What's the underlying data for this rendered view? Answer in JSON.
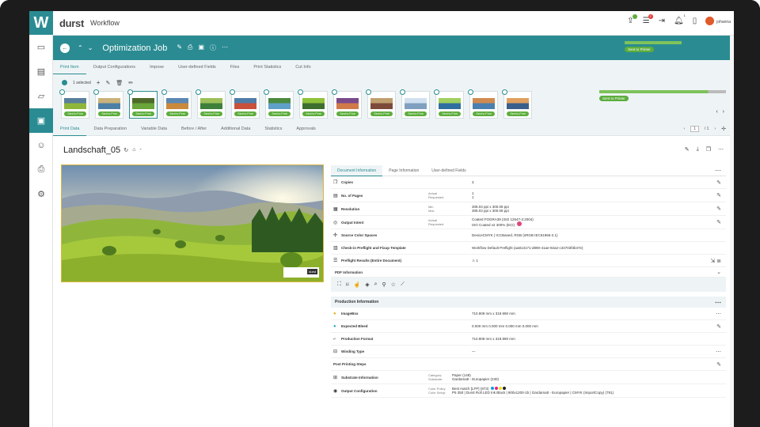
{
  "app": {
    "logo_letter": "W",
    "brand": "durst",
    "name": "Workflow",
    "user": "johanna",
    "notif_counts": [
      "2",
      "1"
    ]
  },
  "colors": {
    "accent": "#2a8c92",
    "success": "#5cad3c",
    "preview_border": "#d9b840"
  },
  "rail": {
    "items": [
      "dashboard-icon",
      "orders-icon",
      "folder-icon",
      "jobs-icon",
      "users-icon",
      "printer-icon",
      "settings-icon"
    ]
  },
  "job": {
    "title": "Optimization Job",
    "status": "Sent to Printer",
    "progress_percent": 100
  },
  "tabs1": [
    "Print Item",
    "Output Configurations",
    "Impose",
    "User-defined Fields",
    "Files",
    "Print Statistics",
    "Cut Info"
  ],
  "selection": {
    "label": "1 selected"
  },
  "thumbs": {
    "pill": "Sent to Print",
    "count": 14,
    "status": "Sent to Printer",
    "progress_percent": 86
  },
  "tabs2": [
    "Print Data",
    "Data Preparation",
    "Variable Data",
    "Before / After",
    "Additional Data",
    "Statistics",
    "Approvals"
  ],
  "pager": {
    "value": "1",
    "total": "/ 1"
  },
  "doc": {
    "title": "Landschaft_05",
    "stamp_brand": "durst"
  },
  "info_tabs": [
    "Document Information",
    "Page Information",
    "User-defined Fields"
  ],
  "doc_info": [
    {
      "label": "Copies",
      "sub": "",
      "value": "3"
    },
    {
      "label": "No. of Pages",
      "sub": "Actual\nRequested",
      "value": "1\n1"
    },
    {
      "label": "Resolution",
      "sub": "Min\nMax",
      "value": "308.03 ppi x 300.08 ppi\n308.03 ppi x 300.08 ppi"
    },
    {
      "label": "Output Intent",
      "sub": "Actual\nRequested",
      "value": "Coated FOGRA39 (ISO 12647-2:2004)\nISO Coated v2 300% (ECI)"
    },
    {
      "label": "Source Color Spaces",
      "sub": "",
      "value": "DeviceCMYK | ICCBased, RGB (sRGB IEC61966-2.1)"
    },
    {
      "label": "Check-in Preflight and Fixup Template",
      "sub": "",
      "value": "Workflow Default Preflight (aa813171-d890-41ae-92a2-c34703f3b47e)"
    },
    {
      "label": "Preflight Results (Entire Document)",
      "sub": "",
      "value": "⚠ 1"
    }
  ],
  "pdf_info_label": "PDF Information",
  "production": {
    "title": "Production Information",
    "rows": [
      {
        "label": "ImageBox",
        "value": "710.909 mm x 319.990 mm"
      },
      {
        "label": "Expected Bleed",
        "value": "0.000 mm   0.000 mm   0.000 mm   0.000 mm"
      },
      {
        "label": "Production Format",
        "value": "710.909 mm x 319.990 mm"
      },
      {
        "label": "Winding Type",
        "value": "—"
      }
    ]
  },
  "post_steps": {
    "title": "Post Printing Steps",
    "rows": [
      {
        "label": "Substrate Information",
        "sub": "Category:\nSubstrate:",
        "value": "Paper (148)\nGardamatt - Europapier (230)"
      },
      {
        "label": "Output Configuration",
        "sub": "Color Policy:\nColor Setup:",
        "value": "Best match [LFP] (973)\nP5 350 | Durst Roll LED Ink Black | 900x1200-1b | Gardamatt - Europapier | CMYK (ImportCopy) (791)"
      }
    ]
  }
}
